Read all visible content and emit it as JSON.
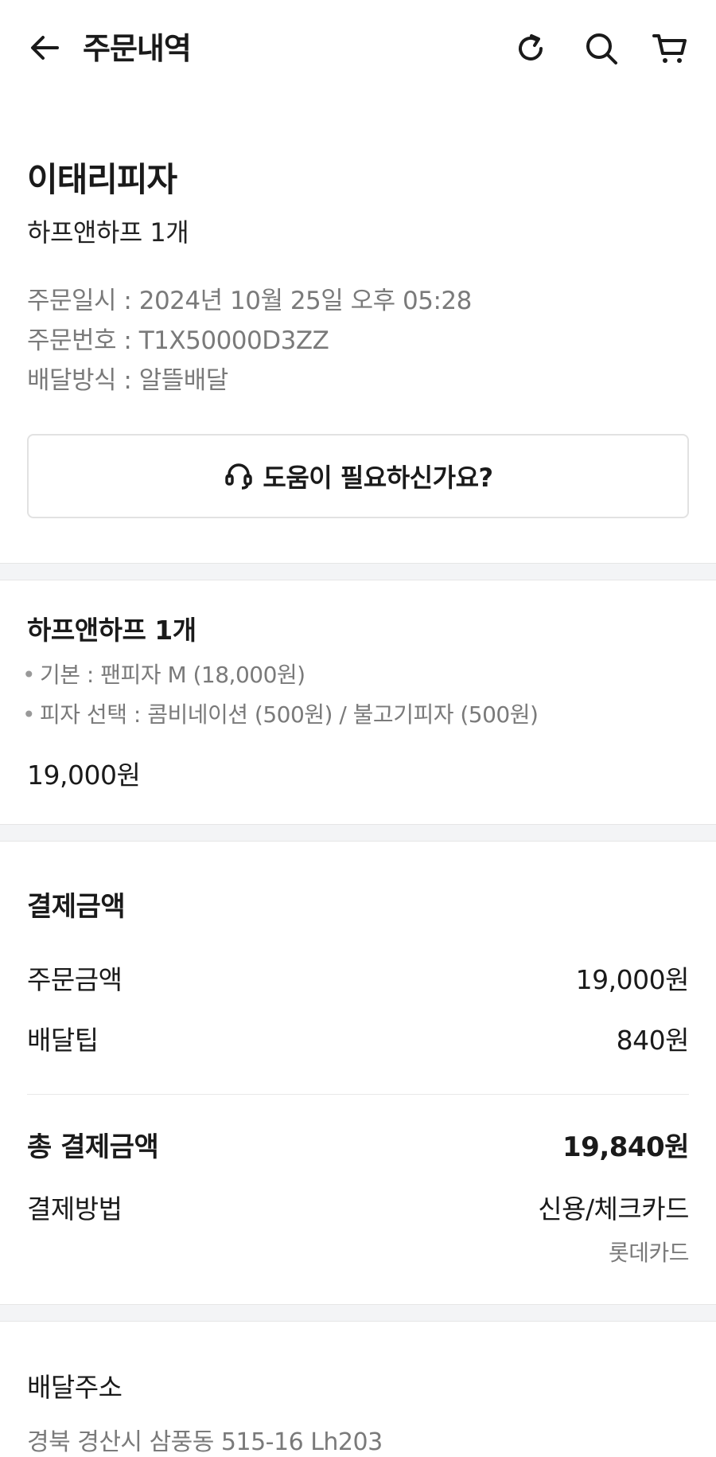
{
  "header": {
    "title": "주문내역"
  },
  "order": {
    "store_name": "이태리피자",
    "summary": "하프앤하프 1개",
    "date_line": "주문일시 : 2024년 10월 25일 오후 05:28",
    "number_line": "주문번호 : T1X50000D3ZZ",
    "delivery_line": "배달방식 : 알뜰배달",
    "help_label": "도움이 필요하신가요?"
  },
  "item": {
    "title": "하프앤하프 1개",
    "options": [
      "기본 : 팬피자 M (18,000원)",
      "피자 선택 : 콤비네이션 (500원) / 불고기피자 (500원)"
    ],
    "price": "19,000원"
  },
  "payment": {
    "title": "결제금액",
    "order_amount_label": "주문금액",
    "order_amount_value": "19,000원",
    "tip_label": "배달팁",
    "tip_value": "840원",
    "total_label": "총 결제금액",
    "total_value": "19,840원",
    "method_label": "결제방법",
    "method_value": "신용/체크카드",
    "card_name": "롯데카드"
  },
  "address": {
    "title": "배달주소",
    "value": "경북 경산시 삼풍동 515-16 Lh203"
  },
  "icons": {
    "back": "arrow-left-icon",
    "refresh": "refresh-icon",
    "search": "search-icon",
    "cart": "cart-icon",
    "headset": "headset-icon"
  }
}
